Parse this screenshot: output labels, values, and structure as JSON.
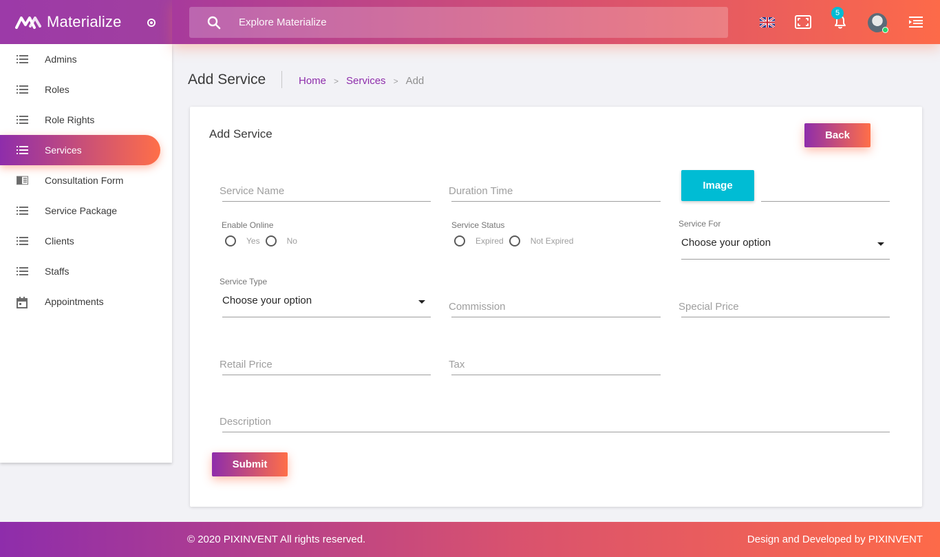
{
  "brand": {
    "name": "Materialize"
  },
  "search": {
    "placeholder": "Explore Materialize"
  },
  "topbar": {
    "notification_count": "5"
  },
  "sidebar": {
    "items": [
      {
        "label": "Admins",
        "icon": "list-icon"
      },
      {
        "label": "Roles",
        "icon": "list-icon"
      },
      {
        "label": "Role Rights",
        "icon": "list-icon"
      },
      {
        "label": "Services",
        "icon": "list-icon",
        "active": true
      },
      {
        "label": "Consultation Form",
        "icon": "chrome-reader-icon"
      },
      {
        "label": "Service Package",
        "icon": "list-icon"
      },
      {
        "label": "Clients",
        "icon": "list-icon"
      },
      {
        "label": "Staffs",
        "icon": "list-icon"
      },
      {
        "label": "Appointments",
        "icon": "calendar-icon"
      }
    ]
  },
  "header": {
    "title": "Add Service",
    "breadcrumb": {
      "home": "Home",
      "services": "Services",
      "current": "Add"
    }
  },
  "card": {
    "title": "Add Service",
    "back_label": "Back",
    "image_label": "Image",
    "submit_label": "Submit"
  },
  "form": {
    "service_name": "Service Name",
    "duration_time": "Duration Time",
    "enable_online": {
      "label": "Enable Online",
      "yes": "Yes",
      "no": "No"
    },
    "service_status": {
      "label": "Service Status",
      "expired": "Expired",
      "not_expired": "Not Expired"
    },
    "service_for": {
      "label": "Service For",
      "value": "Choose your option"
    },
    "service_type": {
      "label": "Service Type",
      "value": "Choose your option"
    },
    "commission": "Commission",
    "special_price": "Special Price",
    "retail_price": "Retail Price",
    "tax": "Tax",
    "description": "Description"
  },
  "footer": {
    "copyright": "© 2020 PIXINVENT All rights reserved.",
    "credit": "Design and Developed by PIXINVENT"
  },
  "colors": {
    "gradient_start": "#8e2dab",
    "gradient_end": "#ff6f48",
    "accent_cyan": "#00bcd4",
    "link": "#8e2dab"
  }
}
